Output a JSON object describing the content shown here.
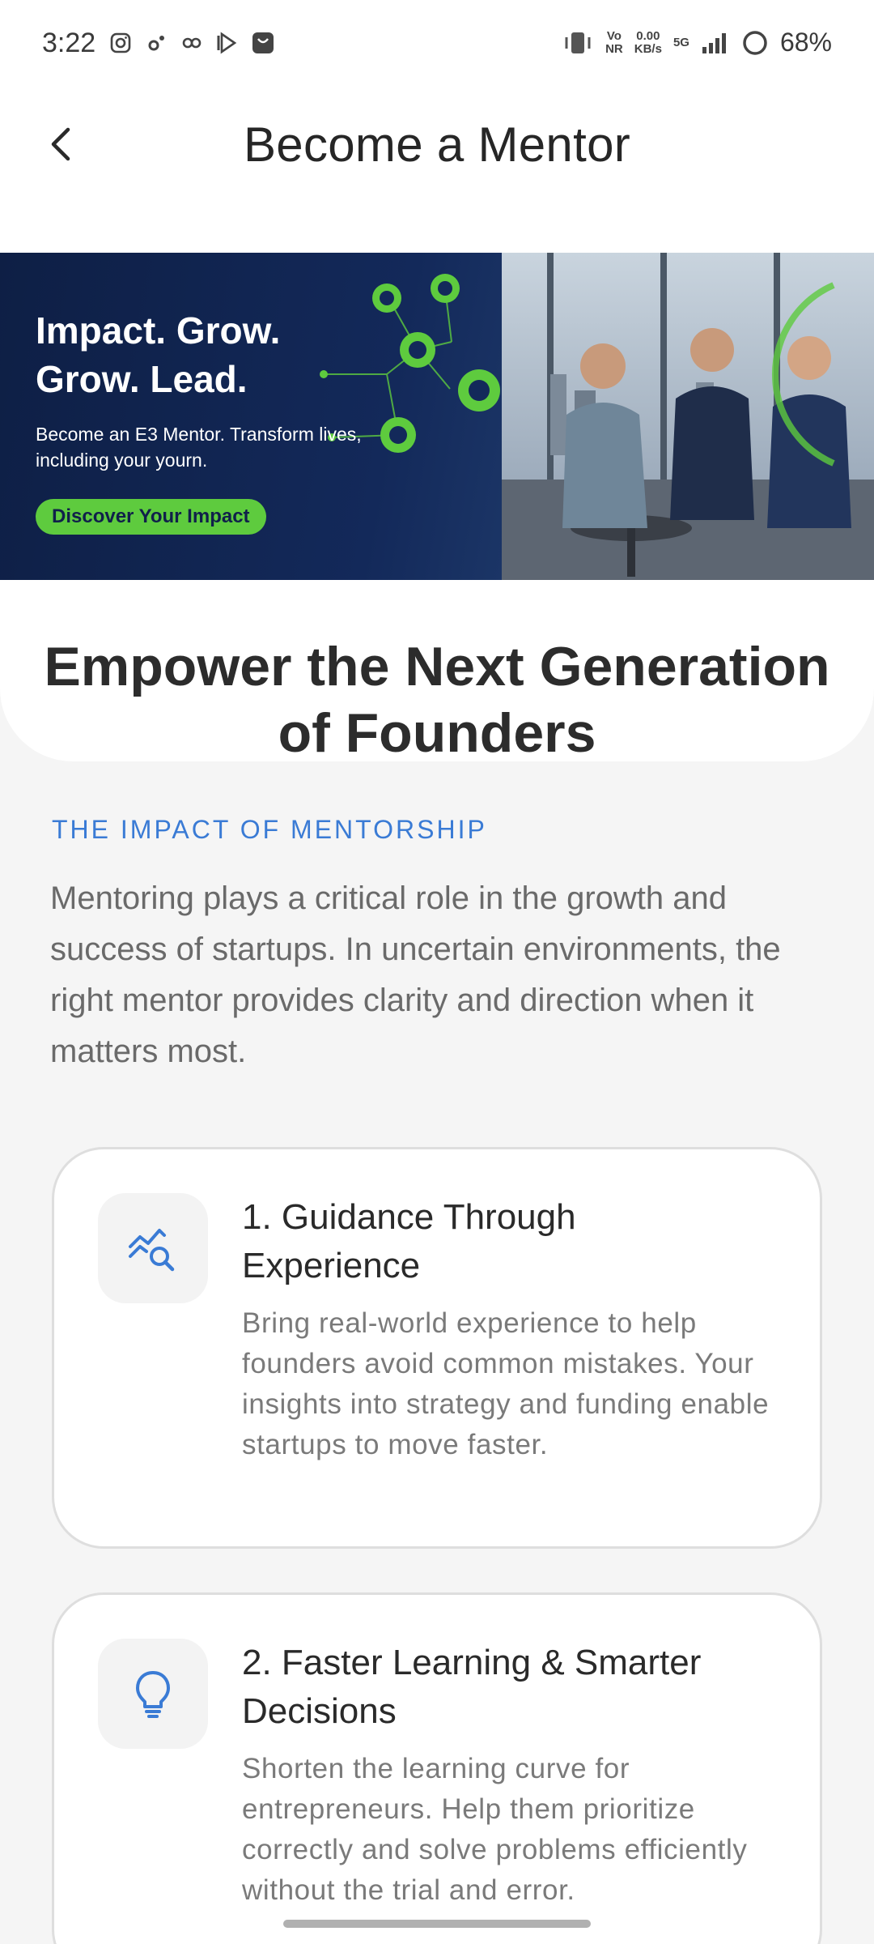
{
  "status_bar": {
    "time": "3:22",
    "network_vo": "Vo",
    "network_nr": "NR",
    "speed_value": "0.00",
    "speed_unit": "KB/s",
    "network_type": "5G",
    "battery_percent": "68%"
  },
  "header": {
    "title": "Become a Mentor",
    "back_icon": "chevron-left-icon"
  },
  "banner": {
    "headline_line1": "Impact. Grow.",
    "headline_line2": "Grow. Lead.",
    "subtext": "Become an E3 Mentor. Transform lives, including your yourn.",
    "cta_label": "Discover Your Impact"
  },
  "hero": {
    "title": "Empower the Next Generation of Founders"
  },
  "section": {
    "eyebrow": "THE IMPACT OF MENTORSHIP",
    "body": "Mentoring plays a critical role in the growth and success of startups. In uncertain environments, the right mentor provides clarity and direction when it matters most."
  },
  "cards": [
    {
      "icon": "chart-search-icon",
      "title": "1. Guidance Through Experience",
      "description": "Bring real-world experience to help founders avoid common mistakes. Your insights into strategy and funding enable startups to move faster."
    },
    {
      "icon": "lightbulb-icon",
      "title": "2. Faster Learning & Smarter Decisions",
      "description": "Shorten the learning curve for entrepreneurs. Help them prioritize correctly and solve problems efficiently without the trial and error."
    }
  ],
  "colors": {
    "accent_blue": "#3a7bd5",
    "banner_navy": "#13295a",
    "banner_green": "#5ecb3e"
  }
}
